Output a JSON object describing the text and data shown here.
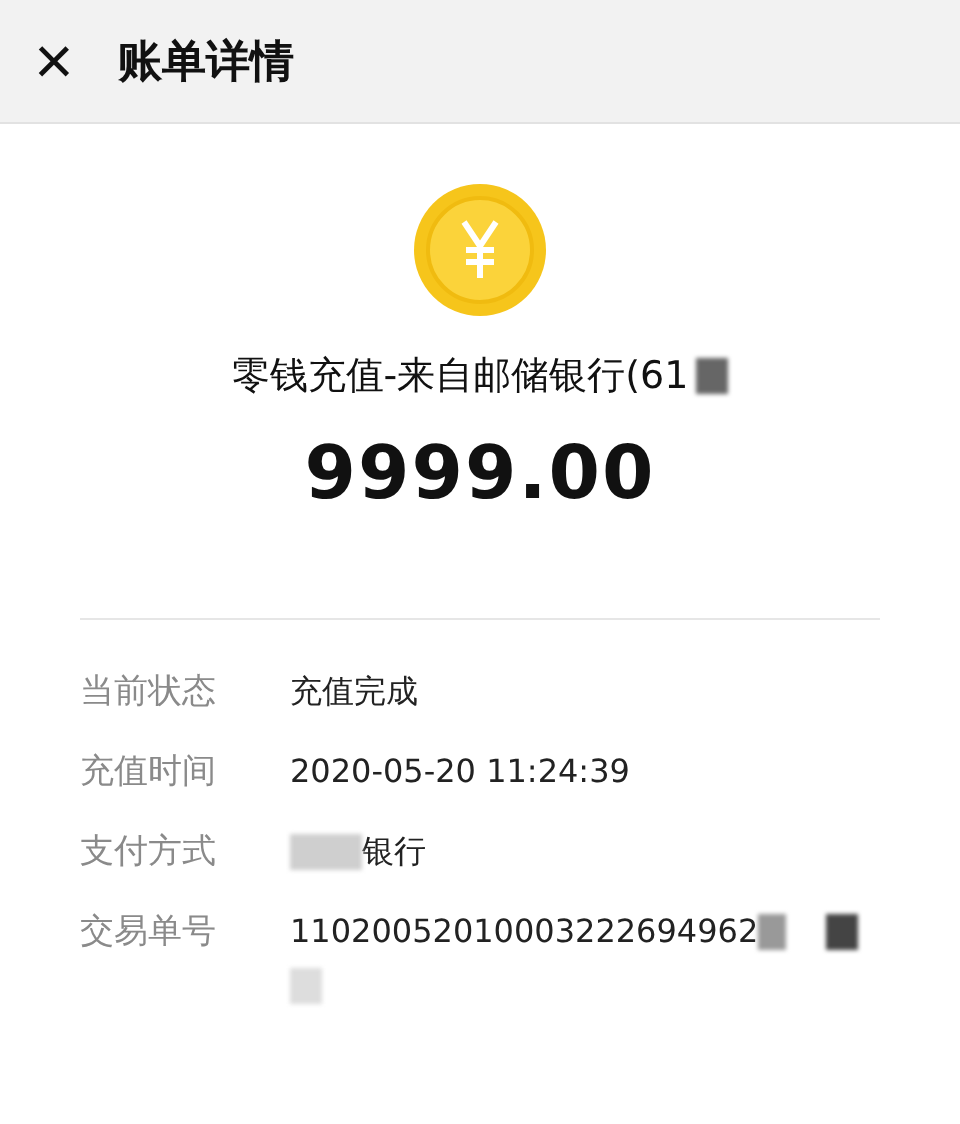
{
  "header": {
    "close": "×",
    "title": "账单详情"
  },
  "summary": {
    "title": "零钱充值-来自邮储银行(61",
    "amount": "9999.00"
  },
  "details": [
    {
      "label": "当前状态",
      "value": "充值完成",
      "redacted": false
    },
    {
      "label": "充值时间",
      "value": "2020-05-20 11:24:39",
      "redacted": false
    },
    {
      "label": "支付方式",
      "value": "银行",
      "redacted": true
    },
    {
      "label": "交易单号",
      "value": "11020052010003222694962",
      "redacted": true
    }
  ]
}
